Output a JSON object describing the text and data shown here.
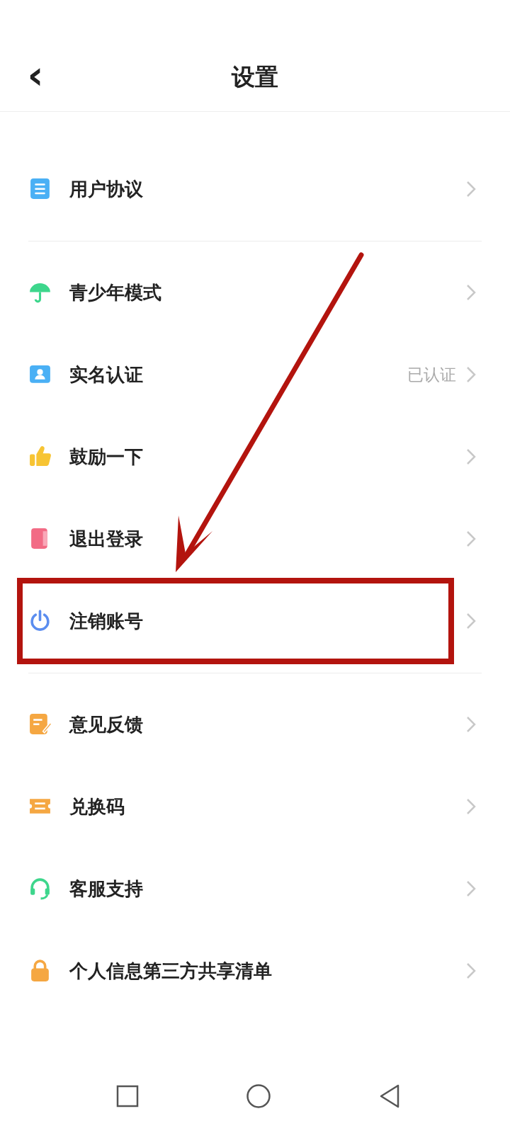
{
  "header": {
    "back": "‹",
    "title": "设置"
  },
  "groups": [
    {
      "items": [
        {
          "label": "用户协议"
        }
      ]
    },
    {
      "items": [
        {
          "label": "青少年模式"
        },
        {
          "label": "实名认证",
          "value": "已认证"
        },
        {
          "label": "鼓励一下"
        },
        {
          "label": "退出登录"
        },
        {
          "label": "注销账号"
        }
      ]
    },
    {
      "items": [
        {
          "label": "意见反馈"
        },
        {
          "label": "兑换码"
        },
        {
          "label": "客服支持"
        },
        {
          "label": "个人信息第三方共享清单"
        }
      ]
    }
  ]
}
